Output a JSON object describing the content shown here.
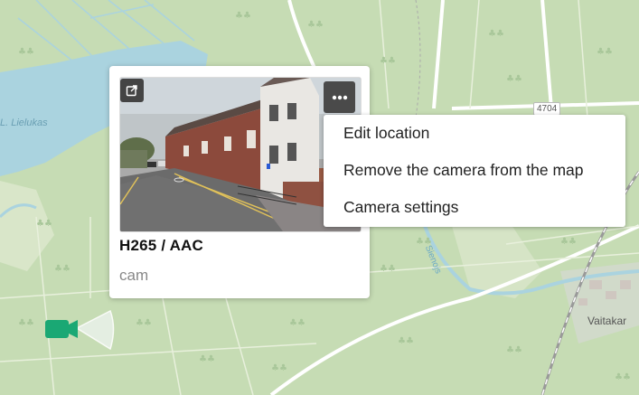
{
  "map": {
    "labels": {
      "lake": "L. Lielukas",
      "road_number": "4704",
      "village": "Vaitakar",
      "river": "Sienojs"
    },
    "colors": {
      "forest": "#c6dcb4",
      "water": "#aad3df",
      "road": "#ffffff",
      "track": "#9ab0a0"
    }
  },
  "popup": {
    "codec": "H265 / AAC",
    "camera_name": "cam",
    "open_icon": "open-in-new-icon",
    "more_icon": "more-horizontal-icon"
  },
  "context_menu": {
    "items": [
      {
        "label": "Edit location"
      },
      {
        "label": "Remove the camera from the map"
      },
      {
        "label": "Camera settings"
      }
    ]
  },
  "camera_marker": {
    "icon": "video-camera-icon",
    "color": "#1aa874"
  }
}
